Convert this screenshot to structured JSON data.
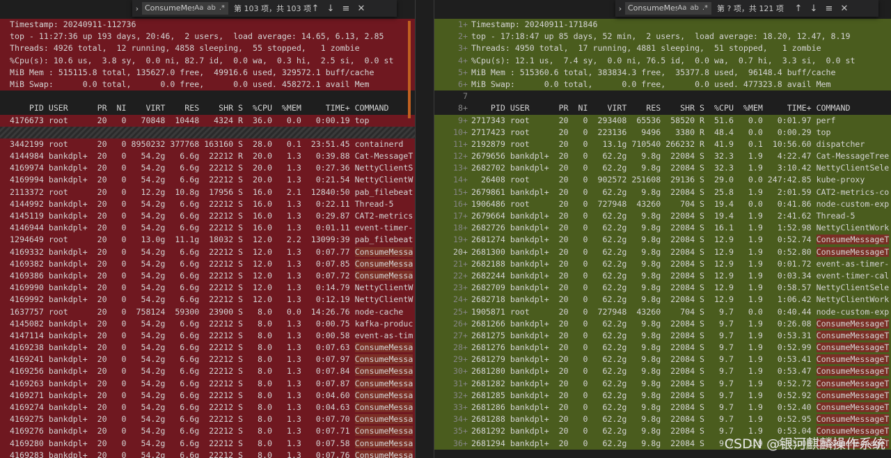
{
  "left": {
    "find": {
      "query": "ConsumeMessa",
      "opt_case": "Aa",
      "opt_word": "ab",
      "opt_regex": ".*",
      "count": "第 103 项，共 103 项"
    },
    "lines": [
      "Timestamp: 20240911-112736",
      "top - 11:27:36 up 193 days, 20:46,  2 users,  load average: 14.65, 6.13, 2.85",
      "Threads: 4926 total,  12 running, 4858 sleeping,  55 stopped,   1 zombie",
      "%Cpu(s): 10.6 us,  3.8 sy,  0.0 ni, 82.7 id,  0.0 wa,  0.3 hi,  2.5 si,  0.0 st",
      "MiB Mem : 515115.8 total, 135627.0 free,  49916.6 used, 329572.1 buff/cache",
      "MiB Swap:      0.0 total,      0.0 free,      0.0 used. 458272.1 avail Mem",
      "",
      "    PID USER      PR  NI    VIRT    RES    SHR S  %CPU  %MEM     TIME+ COMMAND",
      "4176673 root      20   0   70848  10448   4324 R  36.0   0.0   0:00.19 top",
      "",
      "3442199 root      20   0 8950232 377768 163160 S  28.0   0.1  23:51.45 containerd",
      "4144984 bankdpl+  20   0   54.2g   6.6g  22212 R  20.0   1.3   0:39.88 Cat-MessageT",
      "4169974 bankdpl+  20   0   54.2g   6.6g  22212 S  20.0   1.3   0:27.36 NettyClientS",
      "4169994 bankdpl+  20   0   54.2g   6.6g  22212 S  20.0   1.3   0:21.54 NettyClientW",
      "2113372 root      20   0   12.2g  10.8g  17956 S  16.0   2.1  12840:50 pab_filebeat",
      "4144992 bankdpl+  20   0   54.2g   6.6g  22212 S  16.0   1.3   0:22.11 Thread-5",
      "4145119 bankdpl+  20   0   54.2g   6.6g  22212 S  16.0   1.3   0:29.87 CAT2-metrics",
      "4146944 bankdpl+  20   0   54.2g   6.6g  22212 S  16.0   1.3   0:01.11 event-timer-",
      "1294649 root      20   0   13.0g  11.1g  18032 S  12.0   2.2  13099:39 pab_filebeat",
      "4169332 bankdpl+  20   0   54.2g   6.6g  22212 S  12.0   1.3   0:07.77 ConsumeMessa",
      "4169382 bankdpl+  20   0   54.2g   6.6g  22212 S  12.0   1.3   0:07.85 ConsumeMessa",
      "4169386 bankdpl+  20   0   54.2g   6.6g  22212 S  12.0   1.3   0:07.72 ConsumeMessa",
      "4169990 bankdpl+  20   0   54.2g   6.6g  22212 S  12.0   1.3   0:14.79 NettyClientW",
      "4169992 bankdpl+  20   0   54.2g   6.6g  22212 S  12.0   1.3   0:12.19 NettyClientW",
      "1637757 root      20   0  758124  59300  23900 S   8.0   0.0  14:26.76 node-cache",
      "4145082 bankdpl+  20   0   54.2g   6.6g  22212 S   8.0   1.3   0:00.75 kafka-produc",
      "4147114 bankdpl+  20   0   54.2g   6.6g  22212 S   8.0   1.3   0:00.58 event-as-tim",
      "4169238 bankdpl+  20   0   54.2g   6.6g  22212 S   8.0   1.3   0:07.63 ConsumeMessa",
      "4169241 bankdpl+  20   0   54.2g   6.6g  22212 S   8.0   1.3   0:07.97 ConsumeMessa",
      "4169256 bankdpl+  20   0   54.2g   6.6g  22212 S   8.0   1.3   0:07.84 ConsumeMessa",
      "4169263 bankdpl+  20   0   54.2g   6.6g  22212 S   8.0   1.3   0:07.87 ConsumeMessa",
      "4169271 bankdpl+  20   0   54.2g   6.6g  22212 S   8.0   1.3   0:04.60 ConsumeMessa",
      "4169274 bankdpl+  20   0   54.2g   6.6g  22212 S   8.0   1.3   0:04.63 ConsumeMessa",
      "4169275 bankdpl+  20   0   54.2g   6.6g  22212 S   8.0   1.3   0:07.70 ConsumeMessa",
      "4169276 bankdpl+  20   0   54.2g   6.6g  22212 S   8.0   1.3   0:07.71 ConsumeMessa",
      "4169280 bankdpl+  20   0   54.2g   6.6g  22212 S   8.0   1.3   0:07.58 ConsumeMessa",
      "4169283 bankdpl+  20   0   54.2g   6.6g  22212 S   8.0   1.3   0:07.76 ConsumeMessa"
    ]
  },
  "right": {
    "find": {
      "query": "ConsumeMessa",
      "opt_case": "Aa",
      "opt_word": "ab",
      "opt_regex": ".*",
      "count": "第 ? 项，共 121 项"
    },
    "current_line": 20,
    "lines": [
      "Timestamp: 20240911-171846",
      "top - 17:18:47 up 85 days, 52 min,  2 users,  load average: 18.20, 12.47, 8.19",
      "Threads: 4950 total,  17 running, 4881 sleeping,  51 stopped,   1 zombie",
      "%Cpu(s): 12.1 us,  7.4 sy,  0.0 ni, 76.5 id,  0.0 wa,  0.7 hi,  3.3 si,  0.0 st",
      "MiB Mem : 515360.6 total, 383834.3 free,  35377.8 used,  96148.4 buff/cache",
      "MiB Swap:      0.0 total,      0.0 free,      0.0 used. 477323.8 avail Mem",
      "",
      "    PID USER      PR  NI    VIRT    RES    SHR S  %CPU  %MEM     TIME+ COMMAND",
      "2717343 root      20   0  293408  65536  58520 R  51.6   0.0   0:01.97 perf",
      "2717423 root      20   0  223136   9496   3380 R  48.4   0.0   0:00.29 top",
      "2192879 root      20   0   13.1g 710540 266232 R  41.9   0.1  10:56.60 dispatcher",
      "2679656 bankdpl+  20   0   62.2g   9.8g  22084 S  32.3   1.9   4:22.47 Cat-MessageTree",
      "2682702 bankdpl+  20   0   62.2g   9.8g  22084 S  32.3   1.9   3:10.42 NettyClientSele",
      "  26408 root      20   0  902572 251608  29136 S  29.0   0.0 247:42.85 kube-proxy",
      "2679861 bankdpl+  20   0   62.2g   9.8g  22084 S  25.8   1.9   2:01.59 CAT2-metrics-co",
      "1906486 root      20   0  727948  43260    704 S  19.4   0.0   0:41.86 node-custom-exp",
      "2679664 bankdpl+  20   0   62.2g   9.8g  22084 S  19.4   1.9   2:41.62 Thread-5",
      "2682726 bankdpl+  20   0   62.2g   9.8g  22084 S  16.1   1.9   1:52.98 NettyClientWork",
      "2681274 bankdpl+  20   0   62.2g   9.8g  22084 S  12.9   1.9   0:52.74 ConsumeMessageT",
      "2681300 bankdpl+  20   0   62.2g   9.8g  22084 S  12.9   1.9   0:52.80 ConsumeMessageT",
      "2682188 bankdpl+  20   0   62.2g   9.8g  22084 S  12.9   1.9   0:01.72 event-as-timer-",
      "2682244 bankdpl+  20   0   62.2g   9.8g  22084 S  12.9   1.9   0:03.34 event-timer-cal",
      "2682709 bankdpl+  20   0   62.2g   9.8g  22084 S  12.9   1.9   0:58.57 NettyClientSele",
      "2682718 bankdpl+  20   0   62.2g   9.8g  22084 S  12.9   1.9   1:06.42 NettyClientWork",
      "1905871 root      20   0  727948  43260    704 S   9.7   0.0   0:40.44 node-custom-exp",
      "2681266 bankdpl+  20   0   62.2g   9.8g  22084 S   9.7   1.9   0:26.08 ConsumeMessageT",
      "2681275 bankdpl+  20   0   62.2g   9.8g  22084 S   9.7   1.9   0:53.31 ConsumeMessageT",
      "2681276 bankdpl+  20   0   62.2g   9.8g  22084 S   9.7   1.9   0:52.99 ConsumeMessageT",
      "2681279 bankdpl+  20   0   62.2g   9.8g  22084 S   9.7   1.9   0:53.41 ConsumeMessageT",
      "2681280 bankdpl+  20   0   62.2g   9.8g  22084 S   9.7   1.9   0:53.47 ConsumeMessageT",
      "2681282 bankdpl+  20   0   62.2g   9.8g  22084 S   9.7   1.9   0:52.72 ConsumeMessageT",
      "2681285 bankdpl+  20   0   62.2g   9.8g  22084 S   9.7   1.9   0:52.92 ConsumeMessageT",
      "2681286 bankdpl+  20   0   62.2g   9.8g  22084 S   9.7   1.9   0:52.40 ConsumeMessageT",
      "2681288 bankdpl+  20   0   62.2g   9.8g  22084 S   9.7   1.9   0:52.95 ConsumeMessageT",
      "2681292 bankdpl+  20   0   62.2g   9.8g  22084 S   9.7   1.9   0:53.04 ConsumeMessageT",
      "2681294 bankdpl+  20   0   62.2g   9.8g  22084 S   9.7   1.9   0:53.06 ConsumeMessageT"
    ]
  },
  "watermark": "CSDN @银河麒麟操作系统",
  "colors": {
    "removed_bg": "#6f1820",
    "added_bg": "#4a5c1e",
    "match_bg": "#7a2f25"
  }
}
